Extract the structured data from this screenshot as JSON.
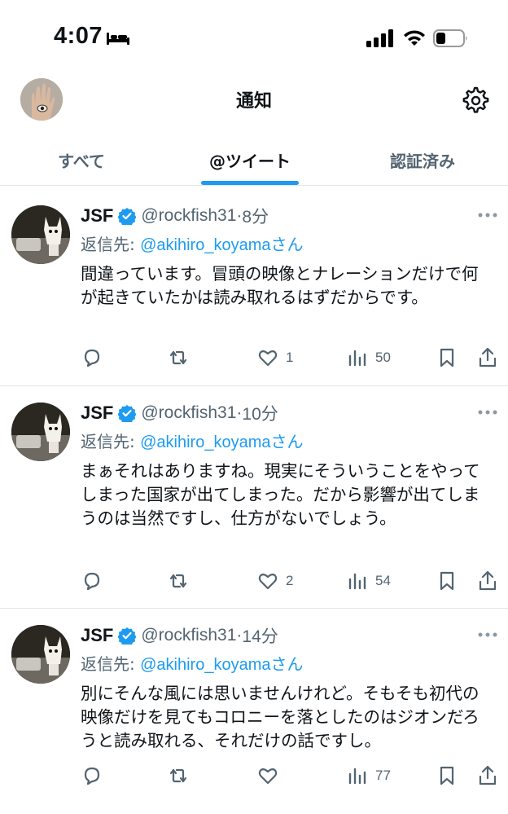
{
  "status": {
    "time": "4:07"
  },
  "header": {
    "title": "通知"
  },
  "tabs": [
    {
      "label": "すべて"
    },
    {
      "label": "@ツイート"
    },
    {
      "label": "認証済み"
    }
  ],
  "tweets": [
    {
      "name": "JSF",
      "handle": "@rockfish31",
      "dot": "·",
      "time": "8分",
      "reply_prefix": "返信先: ",
      "reply_to": "@akihiro_koyama",
      "reply_suffix": "さん",
      "text": "間違っています。冒頭の映像とナレーションだけで何が起きていたかは読み取れるはずだからです。",
      "likes": "1",
      "views": "50"
    },
    {
      "name": "JSF",
      "handle": "@rockfish31",
      "dot": "·",
      "time": "10分",
      "reply_prefix": "返信先: ",
      "reply_to": "@akihiro_koyama",
      "reply_suffix": "さん",
      "text": "まぁそれはありますね。現実にそういうことをやってしまった国家が出てしまった。だから影響が出てしまうのは当然ですし、仕方がないでしょう。",
      "likes": "2",
      "views": "54"
    },
    {
      "name": "JSF",
      "handle": "@rockfish31",
      "dot": "·",
      "time": "14分",
      "reply_prefix": "返信先: ",
      "reply_to": "@akihiro_koyama",
      "reply_suffix": "さん",
      "text": "別にそんな風には思いませんけれど。そもそも初代の映像だけを見てもコロニーを落としたのはジオンだろうと読み取れる、それだけの話ですし。",
      "likes": "",
      "views": "77"
    }
  ],
  "colors": {
    "accent": "#1d9bf0",
    "text": "#0f1419",
    "muted": "#536471"
  }
}
